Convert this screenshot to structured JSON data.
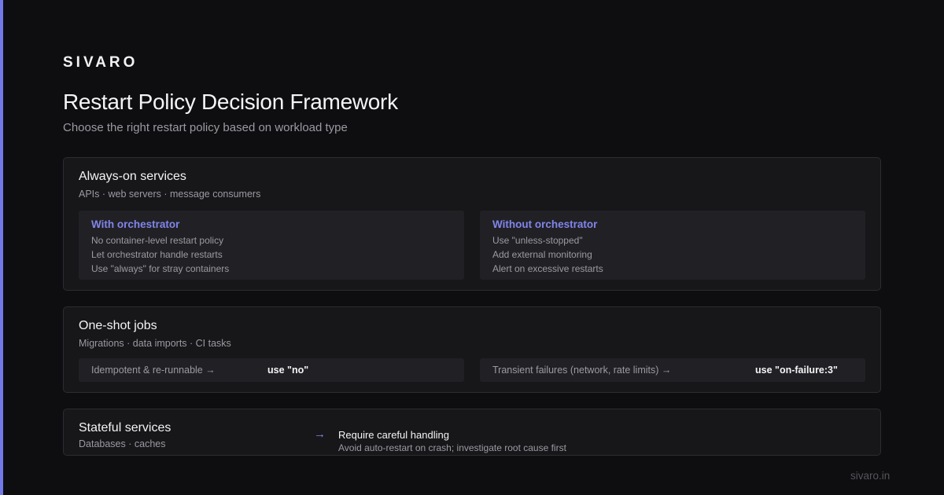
{
  "brand": "SIVARO",
  "title": "Restart Policy Decision Framework",
  "subtitle": "Choose the right restart policy based on workload type",
  "always_on": {
    "title": "Always-on services",
    "examples": "APIs · web servers · message consumers",
    "with_orchestrator": {
      "heading": "With orchestrator",
      "lines": [
        "No container-level restart policy",
        "Let orchestrator handle restarts",
        "Use \"always\" for stray containers"
      ]
    },
    "without_orchestrator": {
      "heading": "Without orchestrator",
      "lines": [
        "Use \"unless-stopped\"",
        "Add external monitoring",
        "Alert on excessive restarts"
      ]
    }
  },
  "one_shot": {
    "title": "One-shot jobs",
    "examples": "Migrations · data imports · CI tasks",
    "idempotent": {
      "label": "Idempotent & re-runnable →",
      "value": "use \"no\""
    },
    "transient": {
      "label": "Transient failures (network, rate limits) →",
      "value": "use \"on-failure:3\""
    }
  },
  "stateful": {
    "title": "Stateful services",
    "examples": "Databases · caches",
    "arrow": "→",
    "heading": "Require careful handling",
    "description": "Avoid auto-restart on crash; investigate root cause first"
  },
  "footer": "sivaro.in",
  "colors": {
    "background": "#0e0e10",
    "card": "#17171a",
    "inner": "#212125",
    "accent": "#7479e8",
    "muted": "#9a9aa2"
  }
}
